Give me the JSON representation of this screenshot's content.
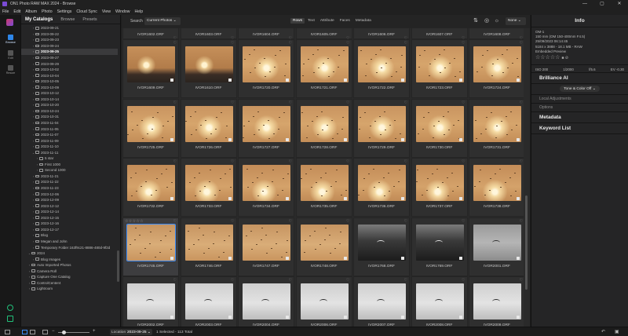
{
  "window": {
    "title": "ON1 Photo RAW MAX 2024 - Browse",
    "controls": [
      "—",
      "▢",
      "✕"
    ]
  },
  "menu": [
    "File",
    "Edit",
    "Album",
    "Photo",
    "Settings",
    "Cloud Sync",
    "View",
    "Window",
    "Help"
  ],
  "rail": {
    "items": [
      {
        "label": "Browse",
        "icon": "browse-icon",
        "active": true
      },
      {
        "label": "Edit",
        "icon": "edit-icon",
        "active": false
      },
      {
        "label": "Resize",
        "icon": "resize-icon",
        "active": false
      }
    ]
  },
  "catalog": {
    "tabs": [
      "My Catalogs",
      "Browse",
      "Presets"
    ],
    "tree": [
      {
        "label": "2023-09-21",
        "indent": 1,
        "exp": "›"
      },
      {
        "label": "2023-09-22",
        "indent": 1,
        "exp": "›"
      },
      {
        "label": "2023-09-23",
        "indent": 1,
        "exp": "›"
      },
      {
        "label": "2023-09-24",
        "indent": 1,
        "exp": "›"
      },
      {
        "label": "2023-09-25",
        "indent": 1,
        "exp": "›",
        "selected": true
      },
      {
        "label": "2023-09-27",
        "indent": 1,
        "exp": "›"
      },
      {
        "label": "2023-09-29",
        "indent": 1,
        "exp": "›"
      },
      {
        "label": "2023-10-02",
        "indent": 1,
        "exp": "›"
      },
      {
        "label": "2023-10-04",
        "indent": 1,
        "exp": "›"
      },
      {
        "label": "2023-10-05",
        "indent": 1,
        "exp": "›"
      },
      {
        "label": "2023-10-09",
        "indent": 1,
        "exp": "›"
      },
      {
        "label": "2023-10-12",
        "indent": 1,
        "exp": "›"
      },
      {
        "label": "2023-10-14",
        "indent": 1,
        "exp": "›"
      },
      {
        "label": "2023-10-20",
        "indent": 1,
        "exp": "›"
      },
      {
        "label": "2023-10-24",
        "indent": 1,
        "exp": "›"
      },
      {
        "label": "2023-10-31",
        "indent": 1,
        "exp": "›"
      },
      {
        "label": "2023-11-04",
        "indent": 1,
        "exp": "›"
      },
      {
        "label": "2023-11-05",
        "indent": 1,
        "exp": "›"
      },
      {
        "label": "2023-11-07",
        "indent": 1,
        "exp": "›"
      },
      {
        "label": "2023-11-09",
        "indent": 1,
        "exp": "›"
      },
      {
        "label": "2023-11-10",
        "indent": 1,
        "exp": "›"
      },
      {
        "label": "2023-11-11",
        "indent": 1,
        "exp": "⌄"
      },
      {
        "label": "5 star",
        "indent": 2,
        "exp": "›"
      },
      {
        "label": "First 1000",
        "indent": 2,
        "exp": "›"
      },
      {
        "label": "Second 1000",
        "indent": 2,
        "exp": "›"
      },
      {
        "label": "2023-11-21",
        "indent": 1,
        "exp": "›"
      },
      {
        "label": "2023-11-22",
        "indent": 1,
        "exp": "›"
      },
      {
        "label": "2023-11-23",
        "indent": 1,
        "exp": "›"
      },
      {
        "label": "2023-12-06",
        "indent": 1,
        "exp": "›"
      },
      {
        "label": "2023-12-09",
        "indent": 1,
        "exp": "›"
      },
      {
        "label": "2023-12-12",
        "indent": 1,
        "exp": "›"
      },
      {
        "label": "2023-12-14",
        "indent": 1,
        "exp": "›"
      },
      {
        "label": "2023-12-15",
        "indent": 1,
        "exp": "›"
      },
      {
        "label": "2023-12-16",
        "indent": 1,
        "exp": "›"
      },
      {
        "label": "2023-12-17",
        "indent": 1,
        "exp": "›"
      },
      {
        "label": "Blog",
        "indent": 1,
        "exp": "›"
      },
      {
        "label": "Megan and John",
        "indent": 1,
        "exp": "›"
      },
      {
        "label": "Temporary Folder 163f9c21-8886-480d-9f2d",
        "indent": 1,
        "exp": "›"
      },
      {
        "label": "2024",
        "indent": 0,
        "exp": "⌄"
      },
      {
        "label": "Blog Images",
        "indent": 1,
        "exp": "›"
      },
      {
        "label": "Auto Imported Photos",
        "indent": 0,
        "exp": "›"
      },
      {
        "label": "Camera Roll",
        "indent": 0,
        "exp": "›"
      },
      {
        "label": "Capture One Catalog",
        "indent": 0,
        "exp": "›"
      },
      {
        "label": "ControlCenter4",
        "indent": 0,
        "exp": "›"
      },
      {
        "label": "Lightroom",
        "indent": 0,
        "exp": "›"
      }
    ]
  },
  "toolbar": {
    "search_label": "Search",
    "search_value": "Current Photos ⌄",
    "view_tabs": [
      "Rows",
      "Text",
      "Attribute",
      "Faces",
      "Metadata"
    ],
    "active_view": "Rows",
    "sort_value": "None ⌄"
  },
  "grid": {
    "columns": 7,
    "top_labels": [
      "IVOR1602.ORF",
      "IVOR1603.ORF",
      "IVOR1604.ORF",
      "IVOR1605.ORF",
      "IVOR1606.ORF",
      "IVOR1607.ORF",
      "IVOR1608.ORF"
    ],
    "rows": [
      {
        "files": [
          "IVOR1609.ORF",
          "IVOR1610.ORF",
          "IVOR1720.ORF",
          "IVOR1721.ORF",
          "IVOR1722.ORF",
          "IVOR1723.ORF",
          "IVOR1724.ORF"
        ],
        "thumbs": [
          "dusk",
          "dusk",
          "sun",
          "sun",
          "sun",
          "sun",
          "sun"
        ]
      },
      {
        "files": [
          "IVOR1725.ORF",
          "IVOR1726.ORF",
          "IVOR1727.ORF",
          "IVOR1728.ORF",
          "IVOR1729.ORF",
          "IVOR1730.ORF",
          "IVOR1731.ORF"
        ],
        "thumbs": [
          "sun",
          "sun",
          "sun",
          "sun",
          "sun",
          "sun",
          "sun"
        ]
      },
      {
        "files": [
          "IVOR1732.ORF",
          "IVOR1733.ORF",
          "IVOR1734.ORF",
          "IVOR1735.ORF",
          "IVOR1736.ORF",
          "IVOR1737.ORF",
          "IVOR1738.ORF"
        ],
        "thumbs": [
          "sunlow",
          "sunlow",
          "sunlow",
          "sunlow",
          "sunlow",
          "sunlow",
          "sunlow"
        ]
      },
      {
        "files": [
          "IVOR1745.ORF",
          "IVOR1746.ORF",
          "IVOR1747.ORF",
          "IVOR1748.ORF",
          "IVOR1768.ORF",
          "IVOR1769.ORF",
          "IVOR2001.ORF"
        ],
        "thumbs": [
          "warm",
          "warm",
          "warm",
          "warm",
          "dark",
          "dark",
          "gray"
        ]
      },
      {
        "files": [
          "IVOR2002.ORF",
          "IVOR2003.ORF",
          "IVOR2004.ORF",
          "IVOR2006.ORF",
          "IVOR2007.ORF",
          "IVOR2008.ORF",
          "IVOR2009.ORF"
        ],
        "thumbs": [
          "white",
          "white",
          "white",
          "white",
          "white",
          "white",
          "white"
        ]
      }
    ],
    "selected_file": "IVOR1745.ORF",
    "selected_stars": "☆☆☆☆☆"
  },
  "info": {
    "header": "Info",
    "camera": "OM-1",
    "lens": "150 mm (OM 150-400mm F4.5)",
    "datetime": "25/09/2023 06:14:45",
    "dims": "5184 x 3888 - 18.1 MB - RAW",
    "preview": "Embedded Preview",
    "stars": "☆☆☆☆☆",
    "color_labels": "■ ⊘",
    "iso": "ISO 200",
    "shutter": "1/2000",
    "aperture": "f/5.6",
    "ev": "EV -0.30",
    "brilliance": "Brilliance AI",
    "tone_color": "Tone & Color  Off ⌄",
    "local_adjustments": "Local Adjustments",
    "options": "Options",
    "metadata": "Metadata",
    "keyword_list": "Keyword List"
  },
  "status": {
    "location_label": "Location",
    "location_value": "2023-09-25 ⌄",
    "summary": "1 Selected - 113 Total"
  }
}
